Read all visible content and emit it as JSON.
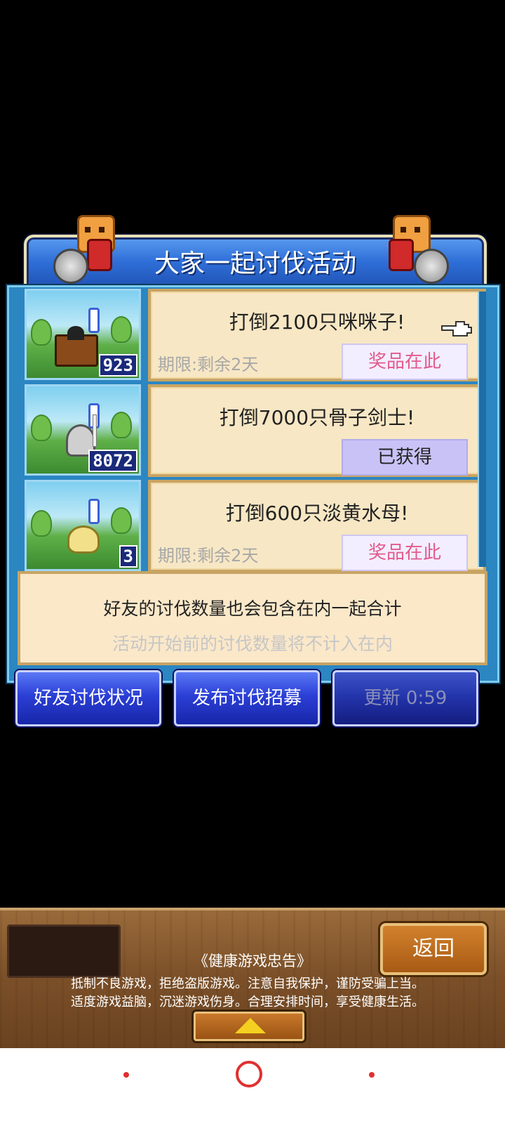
{
  "title": "大家一起讨伐活动",
  "missions": [
    {
      "title": "打倒2100只咪咪子!",
      "deadline": "期限:剩余2天",
      "button": "奖品在此",
      "count": "923",
      "monster": "treasure-chest-monster"
    },
    {
      "title": "打倒7000只骨子剑士!",
      "deadline": "",
      "button": "已获得",
      "count": "8072",
      "monster": "skeleton-swordsman"
    },
    {
      "title": "打倒600只淡黄水母!",
      "deadline": "期限:剩余2天",
      "button": "奖品在此",
      "count": "3",
      "monster": "yellow-jellyfish"
    }
  ],
  "info": {
    "main": "好友的讨伐数量也会包含在内一起合计",
    "sub": "活动开始前的讨伐数量将不计入在内"
  },
  "buttons": {
    "friends_status": "好友讨伐状况",
    "post_recruit": "发布讨伐招募",
    "refresh": "更新 0:59"
  },
  "footer": {
    "back": "返回",
    "health_title": "《健康游戏忠告》",
    "health_line1": "抵制不良游戏，拒绝盗版游戏。注意自我保护，谨防受骗上当。",
    "health_line2": "适度游戏益脑，沉迷游戏伤身。合理安排时间，享受健康生活。"
  },
  "colors": {
    "panel_blue": "#2b86c2",
    "card_bg": "#f7e7c4",
    "reward_text": "#e25a8e",
    "button_blue": "#2b3fd6"
  }
}
